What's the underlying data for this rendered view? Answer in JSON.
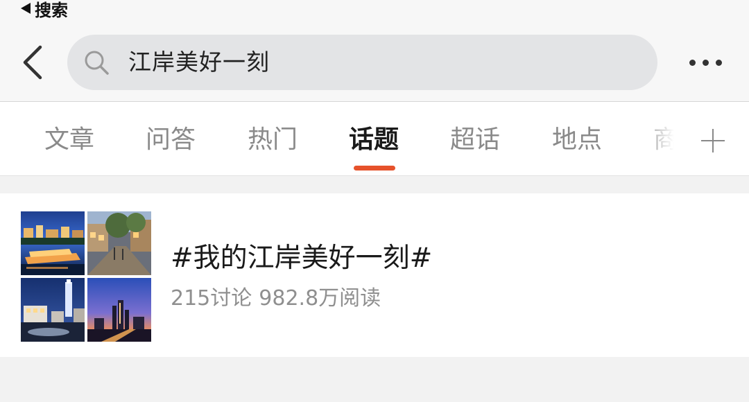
{
  "status_bar": {
    "back_to_app_label": "搜索"
  },
  "search": {
    "query": "江岸美好一刻"
  },
  "tabs": [
    {
      "label": "文章",
      "active": false
    },
    {
      "label": "问答",
      "active": false
    },
    {
      "label": "热门",
      "active": false
    },
    {
      "label": "话题",
      "active": true
    },
    {
      "label": "超话",
      "active": false
    },
    {
      "label": "地点",
      "active": false
    },
    {
      "label": "商",
      "active": false
    }
  ],
  "result": {
    "topic_title": "#我的江岸美好一刻#",
    "discussions": "215讨论",
    "reads": "982.8万阅读"
  },
  "colors": {
    "accent": "#e6522b",
    "background": "#f2f2f2",
    "search_box": "#e3e4e6"
  },
  "icons": [
    "back-triangle-icon",
    "back-chevron-icon",
    "search-icon",
    "more-icon",
    "plus-icon"
  ]
}
